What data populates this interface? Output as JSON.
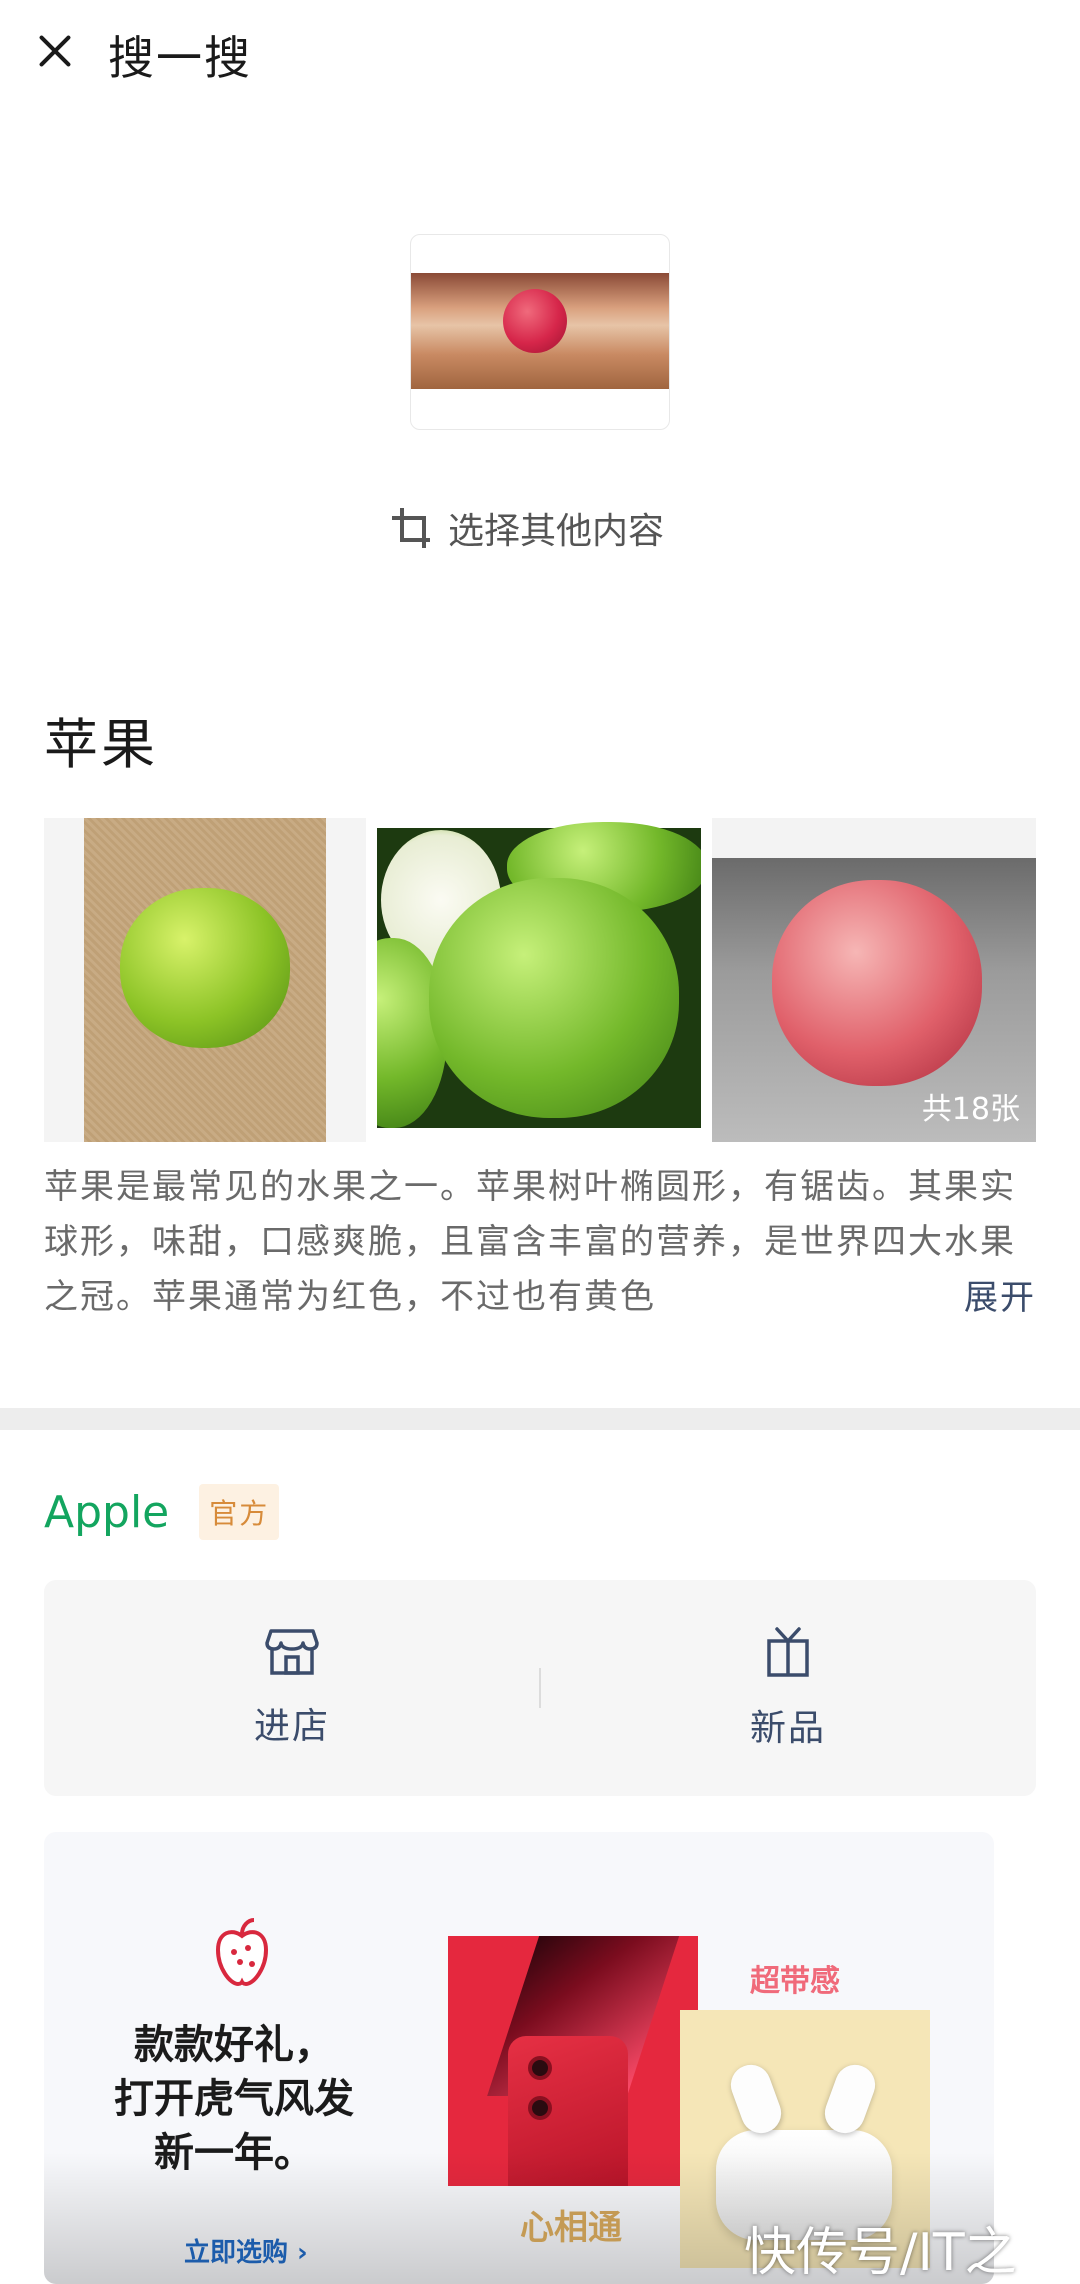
{
  "header": {
    "title": "搜一搜",
    "close_icon": "close-icon"
  },
  "query_image": {
    "select_other_label": "选择其他内容",
    "crop_icon": "crop-icon"
  },
  "entity": {
    "title": "苹果",
    "gallery_count": "共18张",
    "description": "苹果是最常见的水果之一。苹果树叶椭圆形，有锯齿。其果实球形，味甜，口感爽脆，且富含丰富的营养，是世界四大水果之冠。苹果通常为红色，不过也有黄色",
    "expand_label": "展开"
  },
  "brand": {
    "name": "Apple",
    "badge": "官方",
    "actions": [
      {
        "label": "进店",
        "icon": "store-icon"
      },
      {
        "label": "新品",
        "icon": "gift-icon"
      }
    ],
    "banner": {
      "headline_lines": [
        "款款好礼，",
        "打开虎气风发",
        "新一年。"
      ],
      "cta": "立即选购 ›",
      "phone_caption": "心相通",
      "pods_caption": "超带感"
    }
  },
  "watermark": "快传号/IT之",
  "colors": {
    "brand_green": "#13a55f",
    "badge_orange": "#d78b3a",
    "link_blue": "#3b4c6b",
    "cta_blue": "#1c5cab"
  }
}
